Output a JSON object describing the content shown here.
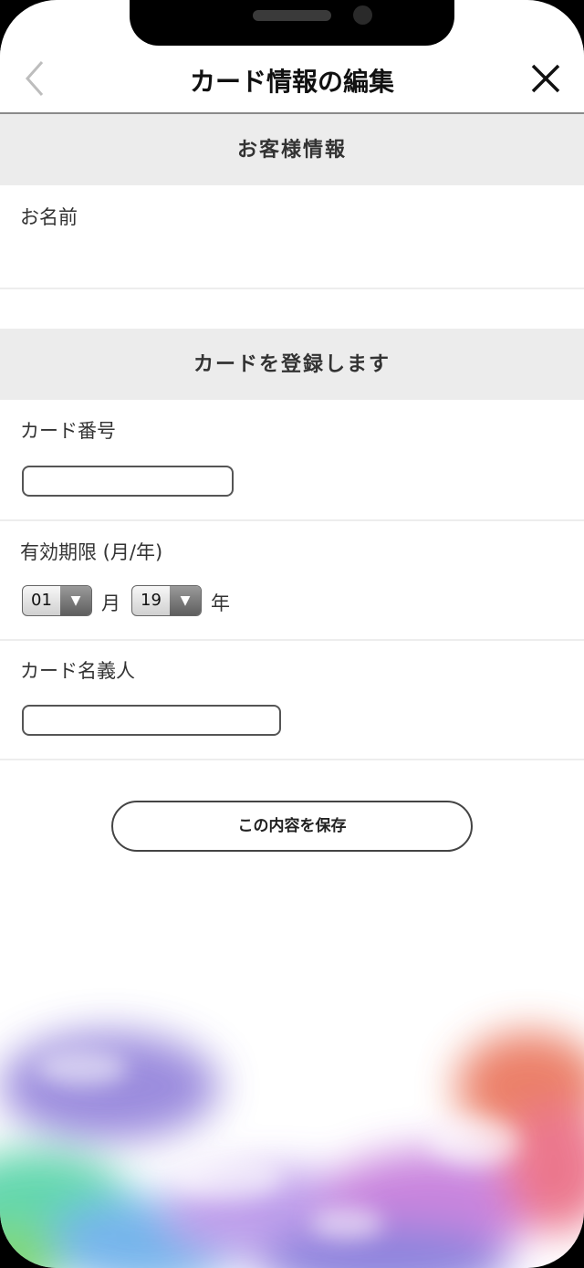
{
  "header": {
    "title": "カード情報の編集"
  },
  "sections": {
    "customer_title": "お客様情報",
    "card_title": "カードを登録します"
  },
  "fields": {
    "name_label": "お名前",
    "name_value": "",
    "card_number_label": "カード番号",
    "card_number_value": "",
    "expiry_label": "有効期限 (月/年)",
    "expiry_month": "01",
    "month_unit": "月",
    "expiry_year": "19",
    "year_unit": "年",
    "holder_label": "カード名義人",
    "holder_value": ""
  },
  "actions": {
    "save_label": "この内容を保存"
  },
  "icons": {
    "back": "chevron-left-icon",
    "close": "close-icon",
    "dropdown": "triangle-down-icon"
  },
  "colors": {
    "section_bg": "#ececec",
    "divider": "#ededed",
    "text": "#333333"
  }
}
